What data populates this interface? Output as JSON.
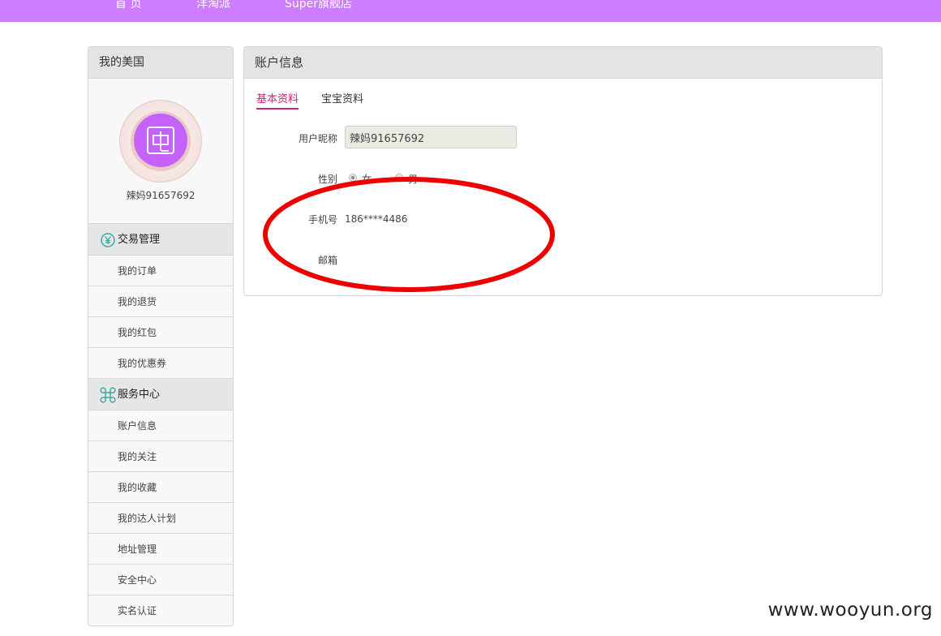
{
  "top_nav": {
    "links": [
      "首 页",
      "洋淘派",
      "Super旗舰店"
    ]
  },
  "sidebar": {
    "title": "我的美国",
    "profile_name": "辣妈91657692",
    "sections": [
      {
        "title": "交易管理",
        "icon": "yen-circle-icon",
        "items": [
          "我的订单",
          "我的退货",
          "我的红包",
          "我的优惠券"
        ]
      },
      {
        "title": "服务中心",
        "icon": "service-knot-icon",
        "items": [
          "账户信息",
          "我的关注",
          "我的收藏",
          "我的达人计划",
          "地址管理",
          "安全中心",
          "实名认证"
        ]
      }
    ]
  },
  "panel": {
    "title": "账户信息",
    "tabs": [
      "基本资料",
      "宝宝资料"
    ],
    "active_tab": "基本资料",
    "form": {
      "nickname_label": "用户昵称",
      "nickname_value": "辣妈91657692",
      "gender_label": "性别",
      "gender_options": [
        "女",
        "男"
      ],
      "gender_selected": "女",
      "phone_label": "手机号",
      "phone_value": "186****4486",
      "email_label": "邮箱"
    }
  },
  "watermark": "www.wooyun.org",
  "colors": {
    "nav_bg": "#cc7eff",
    "accent": "#d0217b",
    "avatar": "#c562ff",
    "annotation": "#ee0000"
  }
}
